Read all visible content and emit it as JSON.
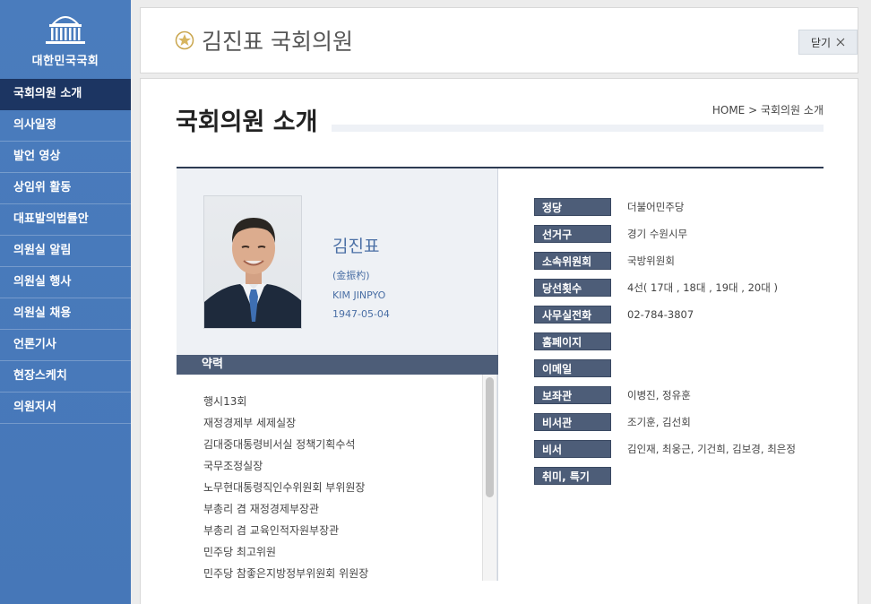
{
  "sidebar": {
    "logo_text": "대한민국국회",
    "items": [
      {
        "label": "국회의원 소개"
      },
      {
        "label": "의사일정"
      },
      {
        "label": "발언 영상"
      },
      {
        "label": "상임위 활동"
      },
      {
        "label": "대표발의법률안"
      },
      {
        "label": "의원실 알림"
      },
      {
        "label": "의원실 행사"
      },
      {
        "label": "의원실 채용"
      },
      {
        "label": "언론기사"
      },
      {
        "label": "현장스케치"
      },
      {
        "label": "의원저서"
      }
    ],
    "active_index": 0
  },
  "header": {
    "title": "김진표 국회의원",
    "close_label": "닫기"
  },
  "main": {
    "page_title": "국회의원 소개",
    "breadcrumb": "HOME > 국회의원 소개"
  },
  "profile": {
    "name_kr": "김진표",
    "name_hanja": "(金振杓)",
    "name_en": "KIM JINPYO",
    "birth": "1947-05-04"
  },
  "career": {
    "heading": "약력",
    "items": [
      "행시13회",
      "재정경제부 세제실장",
      "김대중대통령비서실 정책기획수석",
      "국무조정실장",
      "노무현대통령직인수위원회 부위원장",
      "부총리 겸 재정경제부장관",
      "부총리 겸 교육인적자원부장관",
      "민주당 최고위원",
      "민주당 참좋은지방정부위원회 위원장"
    ]
  },
  "info": [
    {
      "label": "정당",
      "value": "더불어민주당"
    },
    {
      "label": "선거구",
      "value": "경기 수원시무"
    },
    {
      "label": "소속위원회",
      "value": "국방위원회"
    },
    {
      "label": "당선횟수",
      "value": "4선( 17대 , 18대 , 19대 , 20대 )"
    },
    {
      "label": "사무실전화",
      "value": "02-784-3807"
    },
    {
      "label": "홈페이지",
      "value": ""
    },
    {
      "label": "이메일",
      "value": ""
    },
    {
      "label": "보좌관",
      "value": "이병진, 정유훈"
    },
    {
      "label": "비서관",
      "value": "조기훈, 김선회"
    },
    {
      "label": "비서",
      "value": "김인재, 최웅근, 기건희, 김보경, 최은정"
    },
    {
      "label": "취미, 특기",
      "value": ""
    }
  ],
  "colors": {
    "sidebar_bg": "#4a7cbd",
    "sidebar_active": "#1c3562",
    "label_bg": "#4d5d78",
    "name_blue": "#4a6fa5"
  },
  "icons": {
    "logo": "national-assembly-building-icon",
    "seal": "assembly-seal-icon",
    "close": "close-icon"
  }
}
